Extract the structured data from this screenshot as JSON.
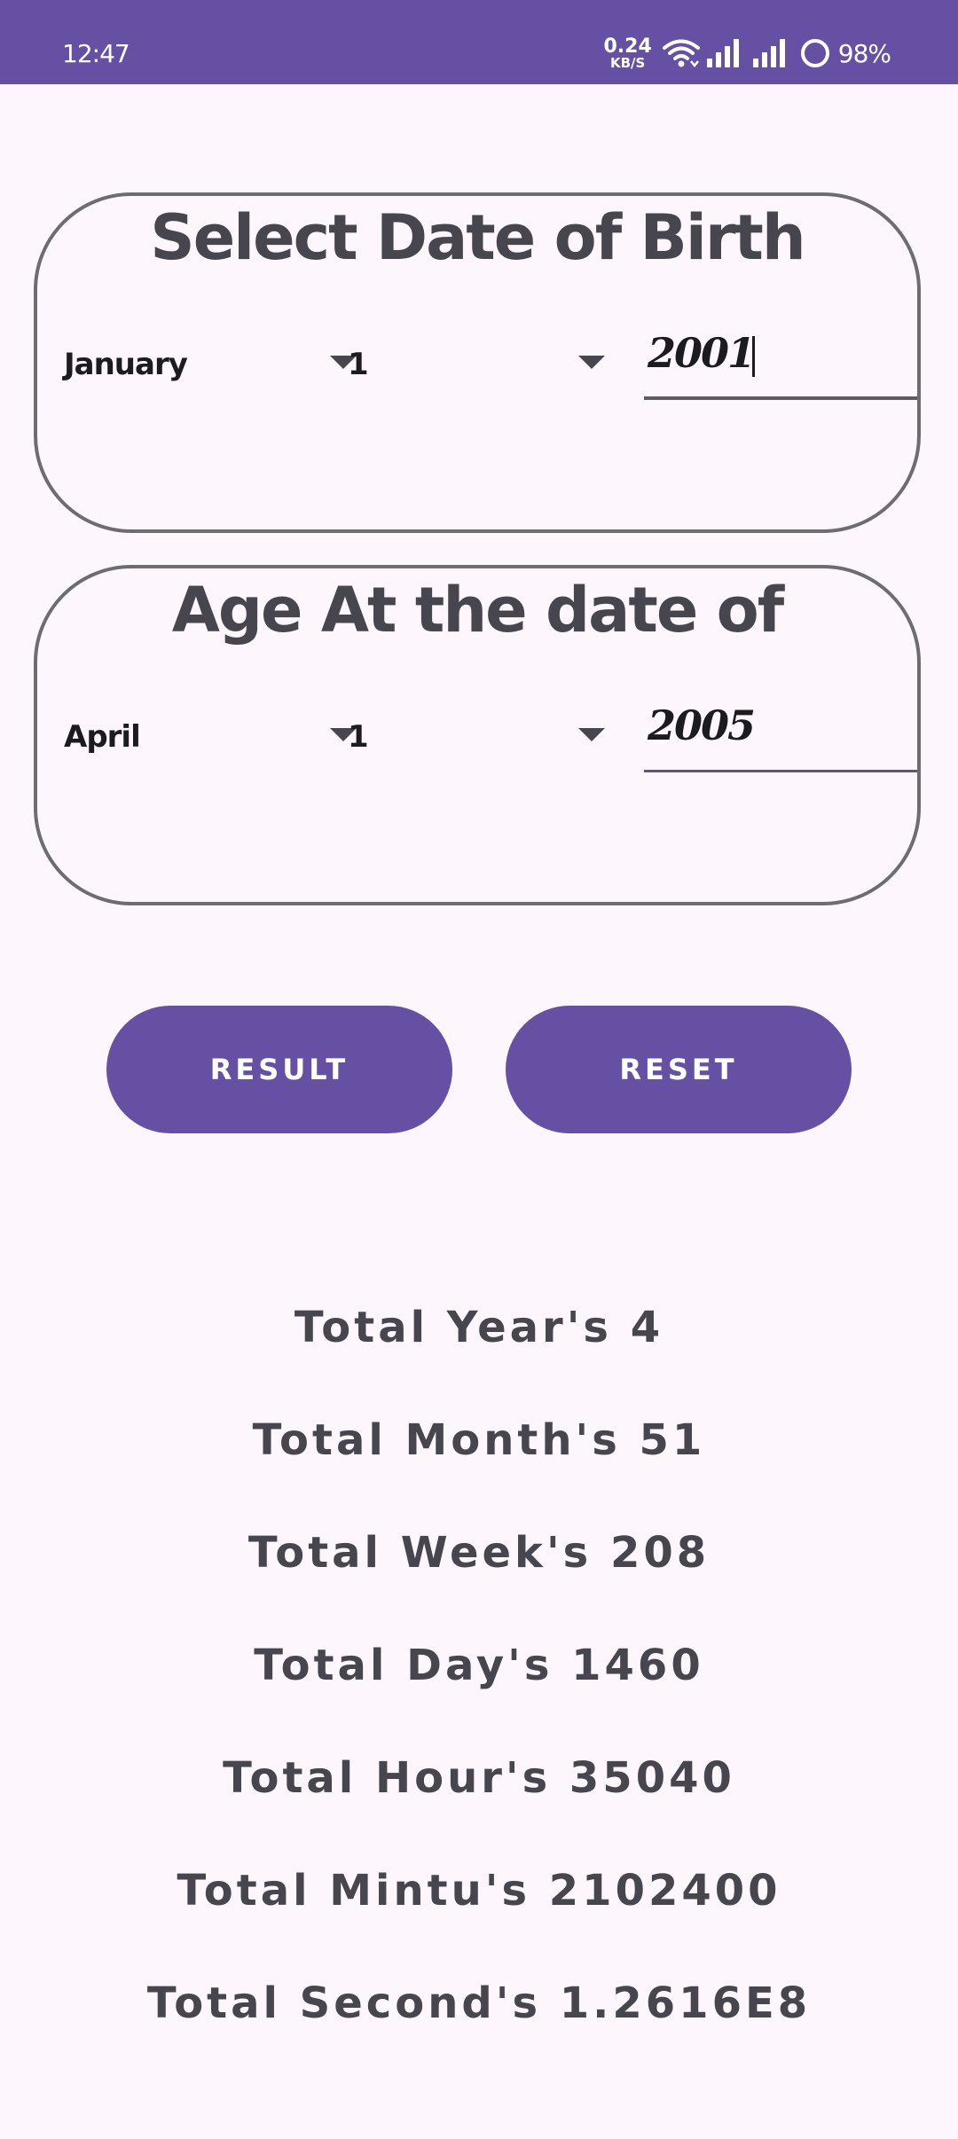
{
  "status_bar": {
    "time": "12:47",
    "net_speed_value": "0.24",
    "net_speed_unit": "KB/S",
    "battery_percent": "98%",
    "accent_color": "#6650a4"
  },
  "dob_card": {
    "title": "Select Date of Birth",
    "month": "January",
    "day": "1",
    "year": "2001"
  },
  "age_card": {
    "title": "Age At the date of",
    "month": "April",
    "day": "1",
    "year": "2005"
  },
  "buttons": {
    "result_label": "RESULT",
    "reset_label": "RESET"
  },
  "results": [
    "Total Year's 4",
    "Total Month's 51",
    "Total Week's 208",
    "Total Day's 1460",
    "Total Hour's 35040",
    "Total Mintu's 2102400",
    "Total Second's 1.2616E8"
  ]
}
